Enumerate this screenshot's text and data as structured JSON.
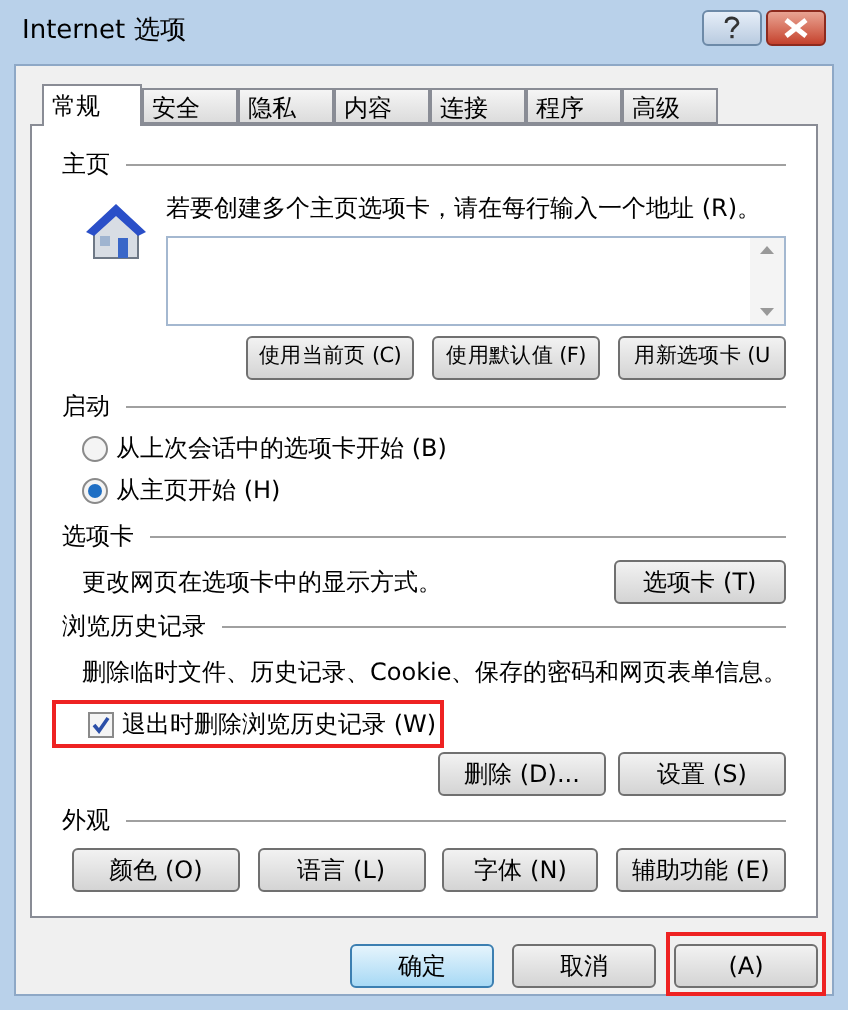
{
  "window": {
    "title": "Internet 选项"
  },
  "tabs": [
    {
      "label": "常规",
      "selected": true
    },
    {
      "label": "安全",
      "selected": false
    },
    {
      "label": "隐私",
      "selected": false
    },
    {
      "label": "内容",
      "selected": false
    },
    {
      "label": "连接",
      "selected": false
    },
    {
      "label": "程序",
      "selected": false
    },
    {
      "label": "高级",
      "selected": false
    }
  ],
  "homepage": {
    "heading": "主页",
    "instruction": "若要创建多个主页选项卡，请在每行输入一个地址 (R)。",
    "buttons": [
      "使用当前页 (C)",
      "使用默认值 (F)",
      "用新选项卡 (U"
    ]
  },
  "startup": {
    "heading": "启动",
    "options": [
      {
        "label": "从上次会话中的选项卡开始 (B)",
        "selected": false
      },
      {
        "label": "从主页开始 (H)",
        "selected": true
      }
    ]
  },
  "tabs_section": {
    "heading": "选项卡",
    "description": "更改网页在选项卡中的显示方式。",
    "button": "选项卡 (T)"
  },
  "history": {
    "heading": "浏览历史记录",
    "description": "删除临时文件、历史记录、Cookie、保存的密码和网页表单信息。",
    "checkbox": {
      "label": "退出时删除浏览历史记录 (W)",
      "checked": true,
      "highlighted": true
    },
    "buttons": [
      "删除 (D)...",
      "设置 (S)"
    ]
  },
  "appearance": {
    "heading": "外观",
    "buttons": [
      "颜色 (O)",
      "语言 (L)",
      "字体 (N)",
      "辅助功能 (E)"
    ]
  },
  "footer": [
    {
      "label": "确定",
      "default": true,
      "highlighted": false
    },
    {
      "label": "取消",
      "default": false,
      "highlighted": false
    },
    {
      "label": "(A)",
      "default": false,
      "highlighted": true
    }
  ]
}
